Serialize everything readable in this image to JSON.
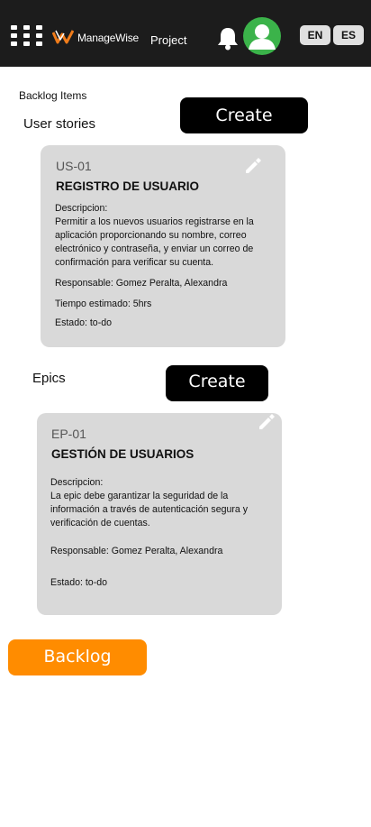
{
  "header": {
    "brand": "ManageWise",
    "project": "Project",
    "languages": [
      "EN",
      "ES"
    ],
    "icons": [
      "apps-grid-icon",
      "managewise-logo-icon",
      "bell-icon",
      "user-avatar-icon"
    ],
    "colors": {
      "bar": "#1c1c1c",
      "avatar": "#3bb34a"
    }
  },
  "section_title": "Backlog Items",
  "user_stories": {
    "title": "User stories",
    "create_label": "Create",
    "card": {
      "id": "US-01",
      "title": "REGISTRO DE USUARIO",
      "description_label": "Descripcion:",
      "description": "Permitir a los nuevos usuarios registrarse en la aplicación proporcionando su nombre, correo electrónico y contraseña, y enviar un correo de confirmación para verificar su cuenta.",
      "responsible": "Responsable: Gomez Peralta, Alexandra",
      "estimated_time": "Tiempo estimado: 5hrs",
      "state": "Estado: to-do"
    }
  },
  "epics": {
    "title": "Epics",
    "create_label": "Create",
    "card": {
      "id": "EP-01",
      "title": "GESTIÓN DE USUARIOS",
      "description_label": "Descripcion:",
      "description": "La epic debe garantizar la seguridad de la información a través de autenticación segura y verificación de cuentas.",
      "responsible": "Responsable: Gomez Peralta, Alexandra",
      "state": "Estado: to-do"
    }
  },
  "backlog_button": {
    "label": "Backlog",
    "color": "#ff8c00"
  }
}
